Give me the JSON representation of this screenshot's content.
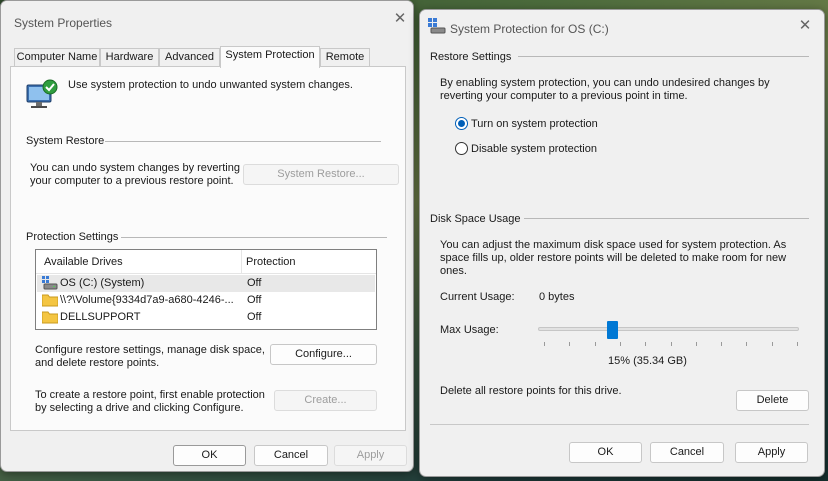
{
  "colors": {
    "accent": "#0078d4",
    "window_bg": "#f0f0f0",
    "panel_bg": "#fbfbfb"
  },
  "left_window": {
    "title": "System Properties",
    "close_icon": "close-icon",
    "tabs": [
      {
        "label": "Computer Name",
        "active": false
      },
      {
        "label": "Hardware",
        "active": false
      },
      {
        "label": "Advanced",
        "active": false
      },
      {
        "label": "System Protection",
        "active": true
      },
      {
        "label": "Remote",
        "active": false
      }
    ],
    "intro_text": "Use system protection to undo unwanted system changes.",
    "intro_icon": "system-protection-icon",
    "system_restore": {
      "heading": "System Restore",
      "description": "You can undo system changes by reverting\nyour computer to a previous restore point.",
      "button": "System Restore..."
    },
    "protection_settings": {
      "heading": "Protection Settings",
      "columns": [
        "Available Drives",
        "Protection"
      ],
      "drives": [
        {
          "name": "OS (C:) (System)",
          "protection": "Off",
          "icon": "system-drive-icon",
          "selected": true
        },
        {
          "name": "\\\\?\\Volume{9334d7a9-a680-4246-...",
          "protection": "Off",
          "icon": "folder-icon",
          "selected": false
        },
        {
          "name": "DELLSUPPORT",
          "protection": "Off",
          "icon": "folder-icon",
          "selected": false
        }
      ],
      "configure_text": "Configure restore settings, manage disk space,\nand delete restore points.",
      "configure_button": "Configure...",
      "create_text": "To create a restore point, first enable protection\nby selecting a drive and clicking Configure.",
      "create_button": "Create..."
    },
    "buttons": {
      "ok": "OK",
      "cancel": "Cancel",
      "apply": "Apply"
    }
  },
  "right_window": {
    "title": "System Protection for OS (C:)",
    "title_icon": "system-protection-icon",
    "close_icon": "close-icon",
    "restore_settings": {
      "heading": "Restore Settings",
      "description": "By enabling system protection, you can undo undesired changes by\nreverting your computer to a previous point in time.",
      "options": [
        {
          "label": "Turn on system protection",
          "selected": true
        },
        {
          "label": "Disable system protection",
          "selected": false
        }
      ]
    },
    "disk_space": {
      "heading": "Disk Space Usage",
      "description": "You can adjust the maximum disk space used for system protection. As\nspace fills up, older restore points will be deleted to make room for new\nones.",
      "current_usage_label": "Current Usage:",
      "current_usage_value": "0 bytes",
      "max_usage_label": "Max Usage:",
      "max_usage_fraction": 0.15,
      "max_usage_readout": "15% (35.34 GB)",
      "delete_text": "Delete all restore points for this drive.",
      "delete_button": "Delete"
    },
    "buttons": {
      "ok": "OK",
      "cancel": "Cancel",
      "apply": "Apply"
    }
  }
}
